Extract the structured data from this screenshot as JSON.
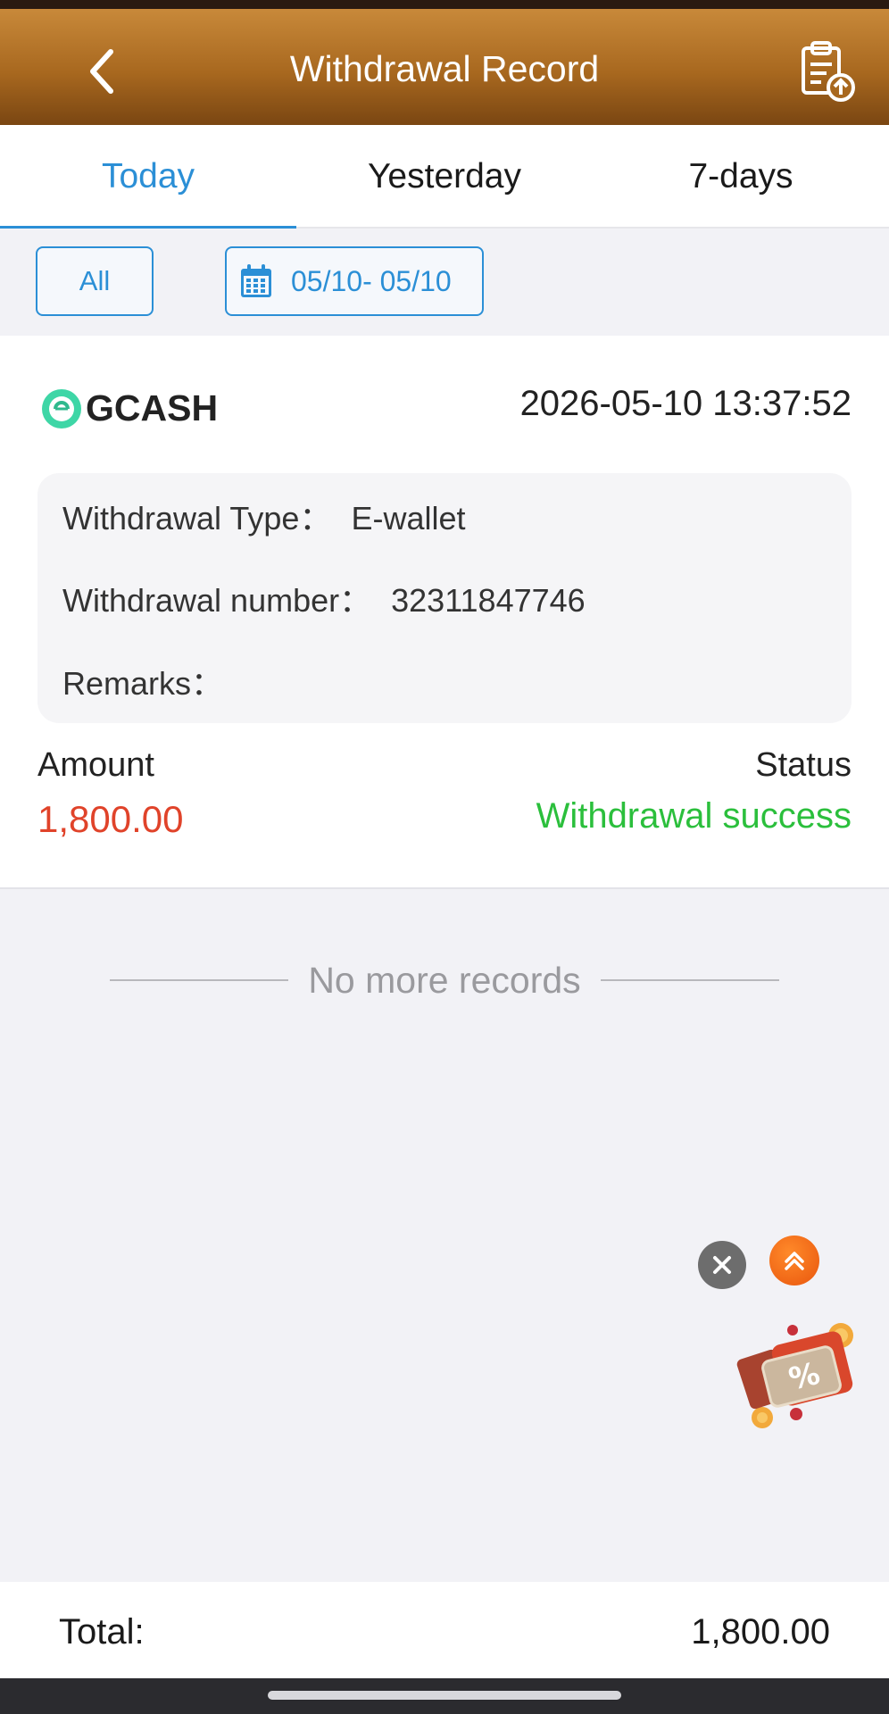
{
  "header": {
    "title": "Withdrawal Record",
    "back_icon": "chevron-left-icon",
    "record_icon": "clipboard-upload-icon"
  },
  "tabs": [
    {
      "label": "Today",
      "active": true
    },
    {
      "label": "Yesterday",
      "active": false
    },
    {
      "label": "7-days",
      "active": false
    }
  ],
  "filters": {
    "all_label": "All",
    "date_range": "05/10- 05/10",
    "date_icon": "calendar-icon"
  },
  "record": {
    "method": "GCASH",
    "method_icon": "gcash-logo-icon",
    "time": "2026-05-10 13:37:52",
    "type_label": "Withdrawal Type：",
    "type_value": "E-wallet",
    "number_label": "Withdrawal number：",
    "number_value": "32311847746",
    "remarks_label": "Remarks：",
    "remarks_value": "",
    "amount_label": "Amount",
    "amount_value": "1,800.00",
    "status_label": "Status",
    "status_value": "Withdrawal success"
  },
  "list_end_text": "No more records",
  "footer": {
    "total_label": "Total:",
    "total_value": "1,800.00"
  },
  "colors": {
    "header_gradient_top": "#c8893a",
    "header_gradient_bottom": "#7a4612",
    "accent_blue": "#2b8fd6",
    "amount_red": "#e0432a",
    "success_green": "#2bbf3c"
  }
}
